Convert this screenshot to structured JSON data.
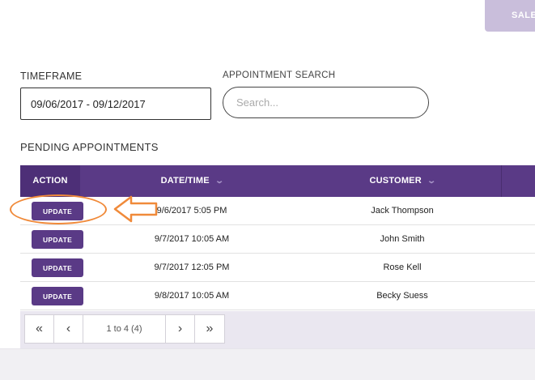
{
  "header": {
    "top_button_label": "SALES"
  },
  "filters": {
    "timeframe_label": "TIMEFRAME",
    "timeframe_value": "09/06/2017 - 09/12/2017",
    "search_label": "APPOINTMENT SEARCH",
    "search_placeholder": "Search..."
  },
  "section": {
    "title": "PENDING APPOINTMENTS"
  },
  "table": {
    "columns": {
      "action": "ACTION",
      "datetime": "DATE/TIME",
      "customer": "CUSTOMER"
    },
    "rows": [
      {
        "action": "UPDATE",
        "datetime": "9/6/2017  5:05 PM",
        "customer": "Jack Thompson"
      },
      {
        "action": "UPDATE",
        "datetime": "9/7/2017  10:05 AM",
        "customer": "John Smith"
      },
      {
        "action": "UPDATE",
        "datetime": "9/7/2017  12:05 PM",
        "customer": "Rose Kell"
      },
      {
        "action": "UPDATE",
        "datetime": "9/8/2017  10:05 AM",
        "customer": "Becky Suess"
      }
    ]
  },
  "pagination": {
    "first_label": "«",
    "prev_label": "‹",
    "info": "1 to 4 (4)",
    "next_label": "›",
    "last_label": "»"
  },
  "icons": {
    "sort": "chevron-down-icon",
    "annotation_arrow": "arrow-left-icon",
    "annotation_circle": "highlight-ellipse"
  },
  "colors": {
    "primary": "#5a3a86",
    "annotation": "#f08a3a",
    "top_button": "#c9bedb"
  }
}
